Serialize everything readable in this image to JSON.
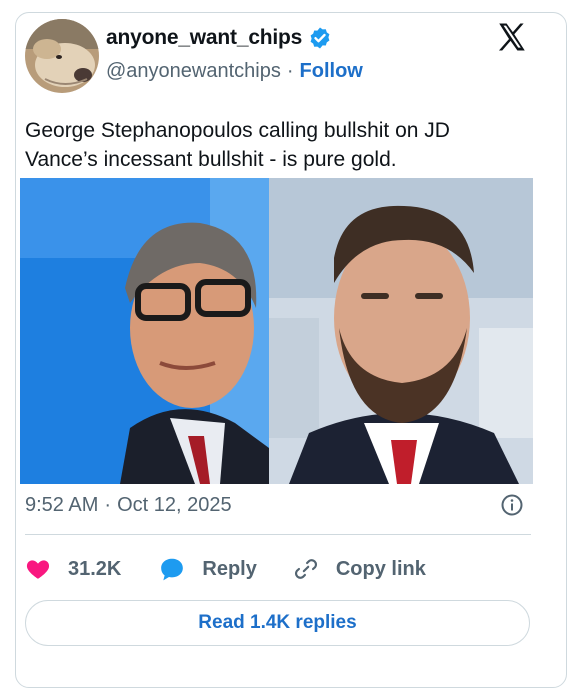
{
  "author": {
    "display_name": "anyone_want_chips",
    "handle": "@anyonewantchips",
    "separator": "·",
    "follow_label": "Follow",
    "verified": true
  },
  "tweet": {
    "text": "George Stephanopoulos calling bullshit on JD Vance’s incessant bullshit - is pure gold.",
    "time": "9:52 AM",
    "separator": "·",
    "date": "Oct 12, 2025"
  },
  "actions": {
    "like_count": "31.2K",
    "reply_label": "Reply",
    "copy_link_label": "Copy link"
  },
  "read_replies_label": "Read 1.4K replies",
  "icons": {
    "verified": "verified-badge-icon",
    "brand": "x-logo-icon",
    "info": "info-icon",
    "like": "heart-icon",
    "reply": "speech-bubble-icon",
    "copy": "link-icon"
  },
  "colors": {
    "accent": "#1d6fc9",
    "verified": "#1d9bf0",
    "like": "#f91880",
    "muted_text": "#536471",
    "border": "#cfd9de"
  }
}
